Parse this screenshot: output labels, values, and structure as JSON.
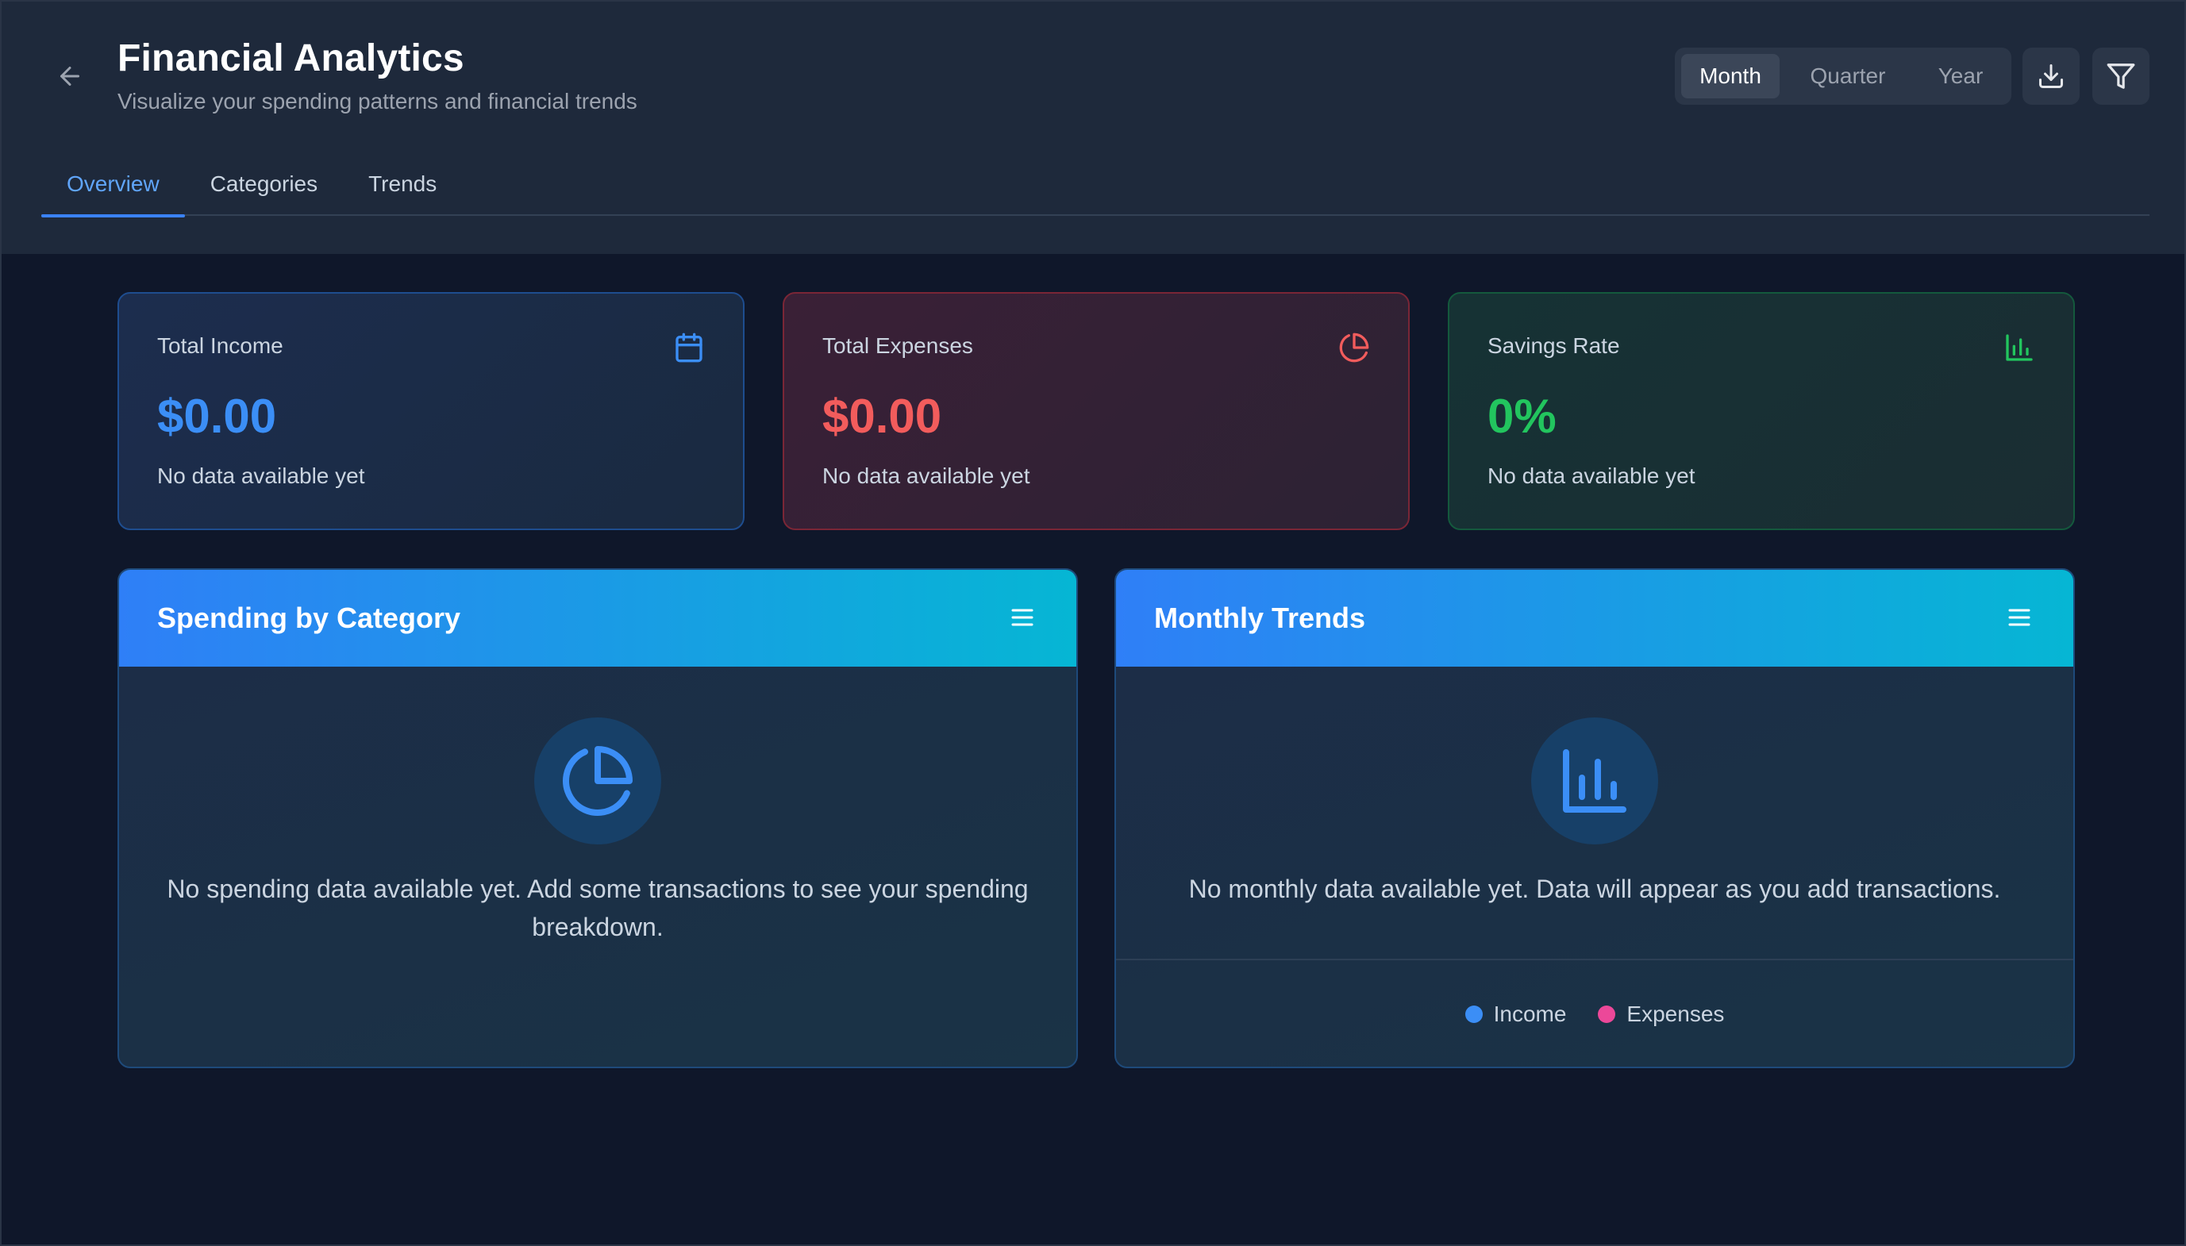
{
  "header": {
    "title": "Financial Analytics",
    "subtitle": "Visualize your spending patterns and financial trends",
    "back_icon": "arrow-left-icon",
    "periods": [
      {
        "label": "Month",
        "active": true
      },
      {
        "label": "Quarter",
        "active": false
      },
      {
        "label": "Year",
        "active": false
      }
    ],
    "download_icon": "download-icon",
    "filter_icon": "filter-icon"
  },
  "tabs": [
    {
      "label": "Overview",
      "active": true
    },
    {
      "label": "Categories",
      "active": false
    },
    {
      "label": "Trends",
      "active": false
    }
  ],
  "stats": {
    "income": {
      "label": "Total Income",
      "value": "$0.00",
      "note": "No data available yet",
      "color": "#3b8ef6",
      "icon": "calendar-icon"
    },
    "expenses": {
      "label": "Total Expenses",
      "value": "$0.00",
      "note": "No data available yet",
      "color": "#f25c5c",
      "icon": "pie-chart-icon"
    },
    "savings": {
      "label": "Savings Rate",
      "value": "0%",
      "note": "No data available yet",
      "color": "#22c55e",
      "icon": "bar-chart-icon"
    }
  },
  "panels": {
    "spending": {
      "title": "Spending by Category",
      "empty_text": "No spending data available yet. Add some transactions to see your spending breakdown.",
      "icon": "pie-chart-icon",
      "menu_icon": "menu-icon"
    },
    "trends": {
      "title": "Monthly Trends",
      "empty_text": "No monthly data available yet. Data will appear as you add transactions.",
      "icon": "bar-chart-icon",
      "menu_icon": "menu-icon",
      "legend": [
        {
          "label": "Income",
          "color": "#3b8ef6"
        },
        {
          "label": "Expenses",
          "color": "#ec4899"
        }
      ]
    }
  },
  "colors": {
    "accent": "#3b82f6",
    "header_gradient_start": "#2f7ff7",
    "header_gradient_end": "#06b6d4"
  }
}
